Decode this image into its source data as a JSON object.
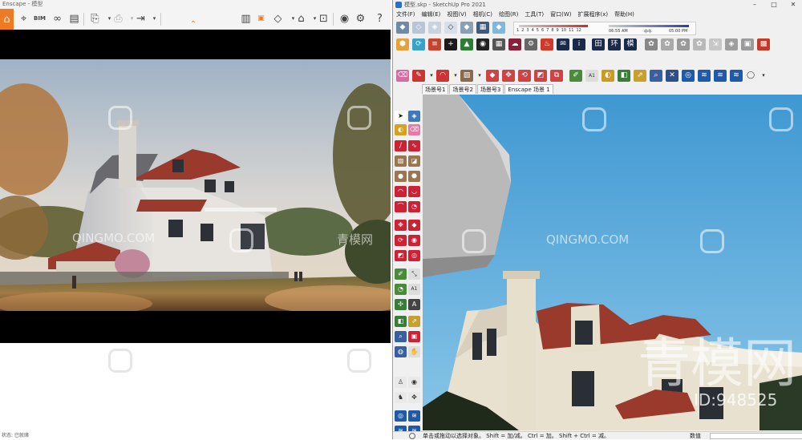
{
  "enscape": {
    "title": "Enscape - 模型",
    "toolbar": {
      "bim_label": "BIM",
      "icons": [
        "home-icon",
        "location-pin-icon",
        "bim-info-icon",
        "binoculars-icon",
        "clapperboard-icon",
        "screenshot-export-icon",
        "batch-export-icon",
        "video-export-icon",
        "map-book-icon",
        "collection-icon",
        "material-diamond-icon",
        "asset-library-icon",
        "vr-headset-icon",
        "visual-settings-icon",
        "settings-gear-icon",
        "help-icon"
      ]
    },
    "status_text": "状态: 已就绪"
  },
  "sketchup": {
    "title": "模型.skp - SketchUp Pro 2021",
    "window_controls": {
      "minimize": "–",
      "maximize": "□",
      "close": "✕"
    },
    "menu": [
      "文件(F)",
      "编辑(E)",
      "视图(V)",
      "相机(C)",
      "绘图(R)",
      "工具(T)",
      "窗口(W)",
      "扩展程序(x)",
      "帮助(H)"
    ],
    "shadow_months": [
      "1",
      "2",
      "3",
      "4",
      "5",
      "6",
      "7",
      "8",
      "9",
      "10",
      "11",
      "12"
    ],
    "shadow_time_start": "06:55 AM",
    "shadow_time_mid": "中午",
    "shadow_time_end": "05:00 PM",
    "toolbar_chars": {
      "table": "田",
      "ring": "环",
      "model": "模"
    },
    "scene_tabs": [
      "场景号1",
      "场景号2",
      "场景号3",
      "Enscape 场景 1"
    ],
    "active_tab_index": 3,
    "status_prompt": "单击或拖动以选择对象。 Shift = 加/减。 Ctrl = 加。 Shift + Ctrl = 减。",
    "measurements_label": "数值",
    "measurements_value": ""
  },
  "watermarks": {
    "site_text": "QINGMO.COM",
    "cn_text": "青模网",
    "big_text": "青模网",
    "id_text": "ID:948525"
  },
  "colors": {
    "enscape_accent": "#ee7a23",
    "sky_blue": "#5aa8d8",
    "roof_red": "#9a3a2c"
  }
}
